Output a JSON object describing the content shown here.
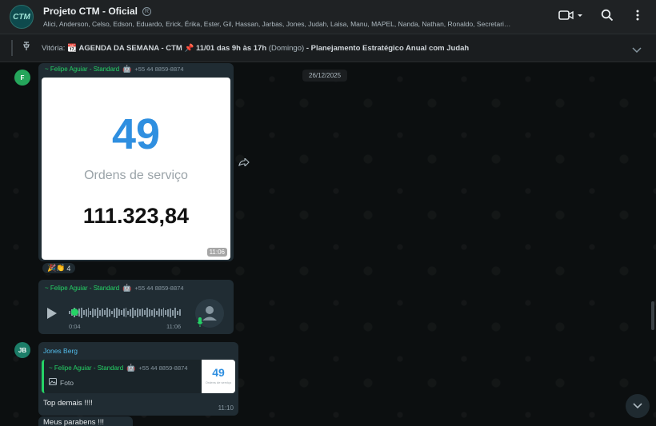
{
  "header": {
    "avatar_text": "CTM",
    "title": "Projeto CTM - Oficial",
    "members": "Alici, Anderson, Celso, Edson, Eduardo, Erick, Érika, Ester, Gil, Hassan, Jarbas, Jones, Judah, Laisa, Manu, MAPEL, Nanda, Nathan, Ronaldo, Secretari…"
  },
  "pinned": {
    "author": "Vitória:",
    "calendar_emoji": "📆",
    "agenda": "AGENDA DA SEMANA - CTM",
    "pin_emoji": "📌",
    "when": "11/01 das 9h às 17h",
    "day": "(Domingo)",
    "topic": "- Planejamento Estratégico Anual com Judah"
  },
  "chat": {
    "date": "26/12/2025",
    "messages": [
      {
        "avatar": "F",
        "sender": "~ Felipe Aguiar - Standard",
        "phone": "+55 44 8859-8874",
        "image": {
          "big_number": "49",
          "caption": "Ordens de serviço",
          "amount": "111.323,84"
        },
        "time": "11:06",
        "reactions": "🎉👏",
        "reaction_count": "4"
      },
      {
        "sender": "~ Felipe Aguiar - Standard",
        "phone": "+55 44 8859-8874",
        "audio": {
          "elapsed": "0:04",
          "progress": 0.02
        },
        "time": "11:06"
      },
      {
        "avatar": "JB",
        "sender": "Jones Berg",
        "quote": {
          "sender": "~ Felipe Aguiar - Standard",
          "phone": "+55 44 8859-8874",
          "label": "Foto",
          "thumb_number": "49",
          "thumb_caption": "Ordens de serviço"
        },
        "text": "Top demais !!!!",
        "time": "11:10"
      },
      {
        "text": "Meus parabens !!!"
      }
    ]
  },
  "colors": {
    "accent": "#25d366",
    "bubble": "#202c33",
    "header": "#1f2224",
    "number_blue": "#2f8fe0"
  }
}
